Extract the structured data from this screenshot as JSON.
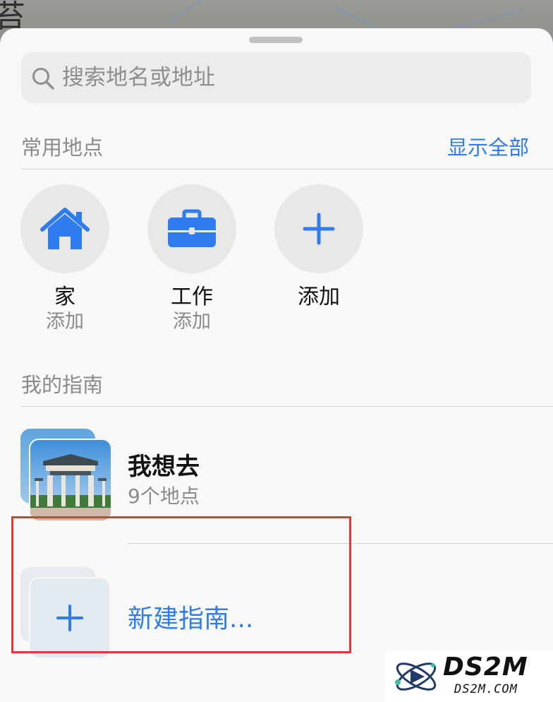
{
  "search": {
    "placeholder": "搜索地名或地址"
  },
  "favorites": {
    "title": "常用地点",
    "show_all": "显示全部",
    "items": [
      {
        "name": "家",
        "sub": "添加",
        "icon": "house-icon"
      },
      {
        "name": "工作",
        "sub": "添加",
        "icon": "briefcase-icon"
      },
      {
        "name": "添加",
        "sub": "",
        "icon": "plus-icon"
      }
    ]
  },
  "guides": {
    "title": "我的指南",
    "items": [
      {
        "title": "我想去",
        "sub": "9个地点"
      }
    ],
    "new_label": "新建指南..."
  },
  "watermark": {
    "big": "DS2M",
    "small": "DS2M.COM"
  },
  "colors": {
    "accent": "#2e7cf0",
    "sheet_bg": "#f8f8f6",
    "highlight": "#e03a3a"
  }
}
